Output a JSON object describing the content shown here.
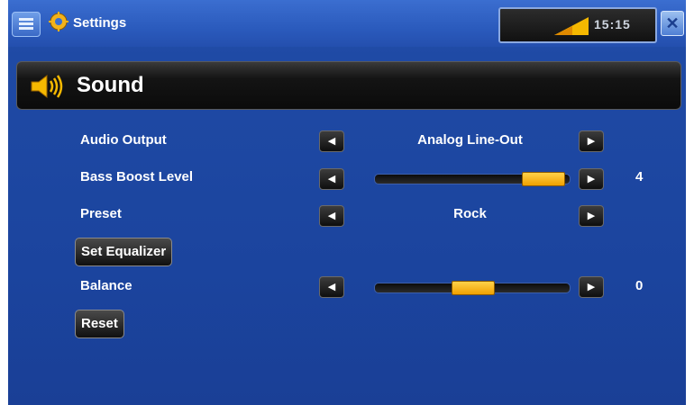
{
  "header": {
    "title": "Settings",
    "clock": "15:15",
    "close_symbol": "✕"
  },
  "section": {
    "title": "Sound"
  },
  "rows": {
    "audio_output": {
      "label": "Audio Output",
      "value": "Analog Line-Out"
    },
    "bass_boost": {
      "label": "Bass Boost Level",
      "value": "4",
      "level_fraction": 0.86
    },
    "preset": {
      "label": "Preset",
      "value": "Rock"
    },
    "balance": {
      "label": "Balance",
      "value": "0",
      "level_fraction": 0.5
    }
  },
  "buttons": {
    "set_equalizer": "Set Equalizer",
    "reset": "Reset"
  },
  "arrows": {
    "left": "◀",
    "right": "▶"
  },
  "colors": {
    "accent": "#f5b800",
    "background": "#1f4aa5"
  },
  "icons": {
    "menu": "menu-icon",
    "settings": "settings-gear-icon",
    "signal": "signal-strength-icon",
    "close": "close-icon",
    "sound": "speaker-icon",
    "left": "arrow-left-icon",
    "right": "arrow-right-icon"
  }
}
